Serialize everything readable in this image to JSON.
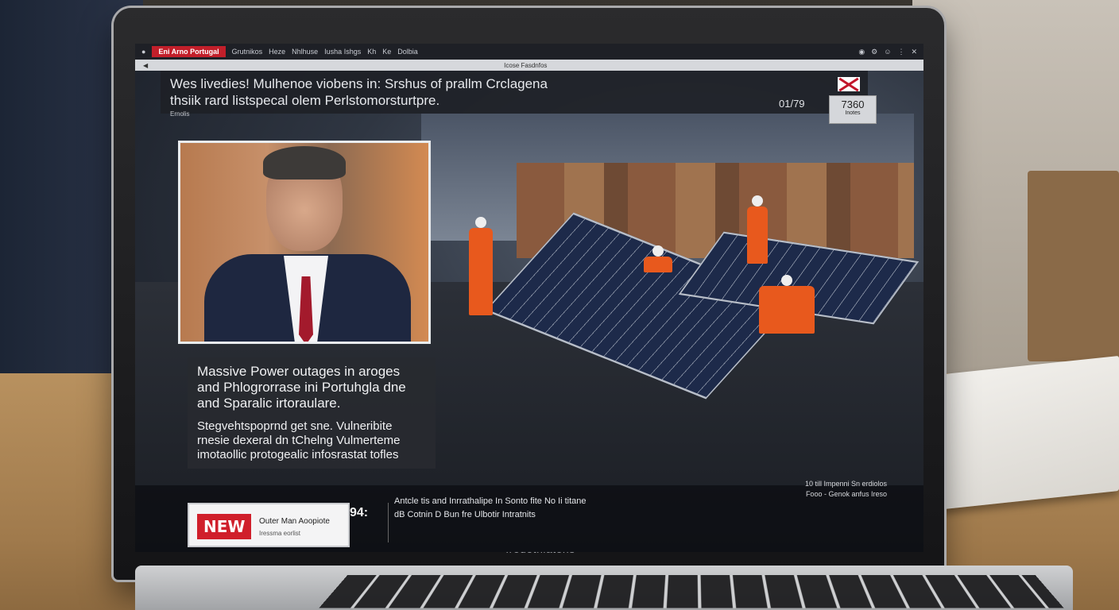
{
  "browser": {
    "tabs": [
      "Eni Arno Portugal",
      "Grutnikos",
      "Heze",
      "Nhlhuse",
      "Iusha Ishgs",
      "Kh",
      "Ke",
      "Dolbia"
    ],
    "active_tab": "Eni Arno Portugal",
    "url": "Icose  Fasdnfos"
  },
  "article": {
    "headline_line1": "Wes livedies! Mulhenoe viobens in: Srshus of prallm Crclagena",
    "headline_line2": "thsiik rard listspecal olem Perlstomorsturtpre.",
    "headline_meta": "Ernolis",
    "timecode": "01/79",
    "rating_big": "7360",
    "rating_small": "Inotes",
    "summary_title": "Massive Power outages in aroges and Phlogrorrase ini Portuhgla dne and Sparalic irtoraulare.",
    "summary_sub": "Stegvehtspoprnd get sne. Vulneribite rnesie dexeral dn tChelng Vulmerteme imotaollic protogealic infosrastat tofles"
  },
  "ticker": {
    "badge": "NEW",
    "badge_line1": "Outer Man Aoopiote",
    "badge_line2": "Iressma eorlist",
    "number": "94:",
    "text_line1": "Antcle tis and Inrrathalipe In Sonto fite No Ii titane",
    "text_line2": "dB Cotnin D Bun fre Ulbotir Intratnits",
    "right_line1": "10 till Impenni Sn erdiolos",
    "right_line2": "Fooo - Genok anfus Ireso"
  },
  "device": {
    "brand": "Iredotniatens"
  }
}
